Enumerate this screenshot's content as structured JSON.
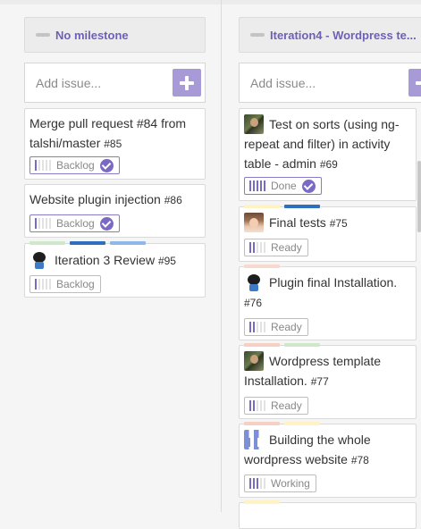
{
  "columns": [
    {
      "title": "No milestone",
      "add_placeholder": "Add issue...",
      "cards": [
        {
          "title": "Merge pull request #84 from talshi/master",
          "number": "#85",
          "status": "Backlog",
          "progress": 1,
          "done_check": true,
          "labels": [],
          "avatar": ""
        },
        {
          "title": "Website plugin injection",
          "number": "#86",
          "status": "Backlog",
          "progress": 1,
          "done_check": true,
          "labels": [],
          "avatar": ""
        },
        {
          "title": "Iteration 3 Review",
          "number": "#95",
          "status": "Backlog",
          "progress": 1,
          "done_check": false,
          "labels": [
            "#cfe8c9",
            "#2f6fbf",
            "#8fb8e8"
          ],
          "avatar": "github-octocat-icon"
        }
      ]
    },
    {
      "title": "Iteration4 - Wordpress te...",
      "add_placeholder": "Add issue...",
      "cards": [
        {
          "title": "Test on sorts (using ng-repeat and filter) in activity table - admin",
          "number": "#69",
          "status": "Done",
          "progress": 5,
          "done_check": true,
          "labels": [],
          "avatar": "user-photo-avatar"
        },
        {
          "title": "Final tests",
          "number": "#75",
          "status": "Ready",
          "progress": 2,
          "done_check": false,
          "labels": [
            "#fff3c4",
            "#2f6fbf"
          ],
          "avatar": "user-woman-avatar"
        },
        {
          "title": "Plugin final Installation.",
          "number": "#76",
          "status": "Ready",
          "progress": 2,
          "done_check": false,
          "labels": [
            "#f7d9d0"
          ],
          "avatar": "github-octocat-icon"
        },
        {
          "title": "Wordpress template Installation.",
          "number": "#77",
          "status": "Ready",
          "progress": 2,
          "done_check": false,
          "labels": [
            "#f7d0c4",
            "#cfe8c9"
          ],
          "avatar": "user-photo-avatar"
        },
        {
          "title": "Building the whole wordpress website",
          "number": "#78",
          "status": "Working",
          "progress": 3,
          "done_check": false,
          "labels": [
            "#f7d0c4",
            "#fff3c4"
          ],
          "avatar": "identicon-avatar"
        }
      ]
    }
  ],
  "colors": {
    "accent": "#6f5fb8",
    "button": "#a89ad6",
    "progress_on": "#7a6ac4"
  }
}
